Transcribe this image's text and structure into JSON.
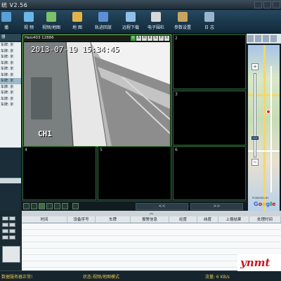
{
  "window": {
    "title": "统 V2.56"
  },
  "toolbar": {
    "items": [
      {
        "label": "播",
        "icon": "player-icon",
        "color": "#5aa0d8"
      },
      {
        "label": "视 频",
        "icon": "video-icon",
        "color": "#6bb7e8"
      },
      {
        "label": "视频/地图",
        "icon": "video-map-icon",
        "color": "#7cc26a"
      },
      {
        "label": "地 图",
        "icon": "map-icon",
        "color": "#e3b34a"
      },
      {
        "label": "轨迹回放",
        "icon": "track-playback-icon",
        "color": "#5d8fd6"
      },
      {
        "label": "远程下载",
        "icon": "remote-download-icon",
        "color": "#8fc0e6"
      },
      {
        "label": "电子围栏",
        "icon": "geofence-icon",
        "color": "#d8d8d8"
      },
      {
        "label": "参数设置",
        "icon": "settings-icon",
        "color": "#c9a45e"
      },
      {
        "label": "日 志",
        "icon": "log-icon",
        "color": "#9ab4d0"
      }
    ]
  },
  "left_panel": {
    "header": "器",
    "tree": [
      {
        "label": "车牌: 京",
        "selected": false
      },
      {
        "label": "车牌: 京",
        "selected": false
      },
      {
        "label": "车牌: 京",
        "selected": false
      },
      {
        "label": "车牌: 京",
        "selected": false
      },
      {
        "label": "车牌: 京",
        "selected": false
      },
      {
        "label": "车牌: 京",
        "selected": false
      },
      {
        "label": "车牌: 京",
        "selected": true
      },
      {
        "label": "车牌: 京",
        "selected": false
      },
      {
        "label": "车牌: 京",
        "selected": false
      },
      {
        "label": "车牌: 京",
        "selected": false
      },
      {
        "label": "车牌: 京",
        "selected": false
      }
    ],
    "lower_lines": [
      "",
      "",
      "",
      "",
      "",
      "以来扣"
    ]
  },
  "video": {
    "cell1": {
      "name": "Hais403  12886",
      "controls": [
        "V",
        "A",
        "H",
        "R",
        "S",
        "P",
        "X"
      ],
      "osd_time": "2013-07-19  15:34:45",
      "osd_channel": "CH1"
    },
    "cells": [
      "2",
      "3",
      "4",
      "5",
      "6"
    ],
    "nav_prev": "<<",
    "nav_next": ">>"
  },
  "map": {
    "powered_by": "POWERED BY",
    "logo": "Google",
    "zoom_in": "+",
    "zoom_out": "−"
  },
  "alarm_table": {
    "split_handle": "︽",
    "columns": [
      "时间",
      "设备序号",
      "车牌",
      "报警信息",
      "经度",
      "纬度",
      "上报结果",
      "处理时间"
    ]
  },
  "status": {
    "server": "数据服务器正常!",
    "mode": "状态:视频/地图模式",
    "traffic": "流量: 6 KB/s"
  },
  "watermark": "ynmt"
}
